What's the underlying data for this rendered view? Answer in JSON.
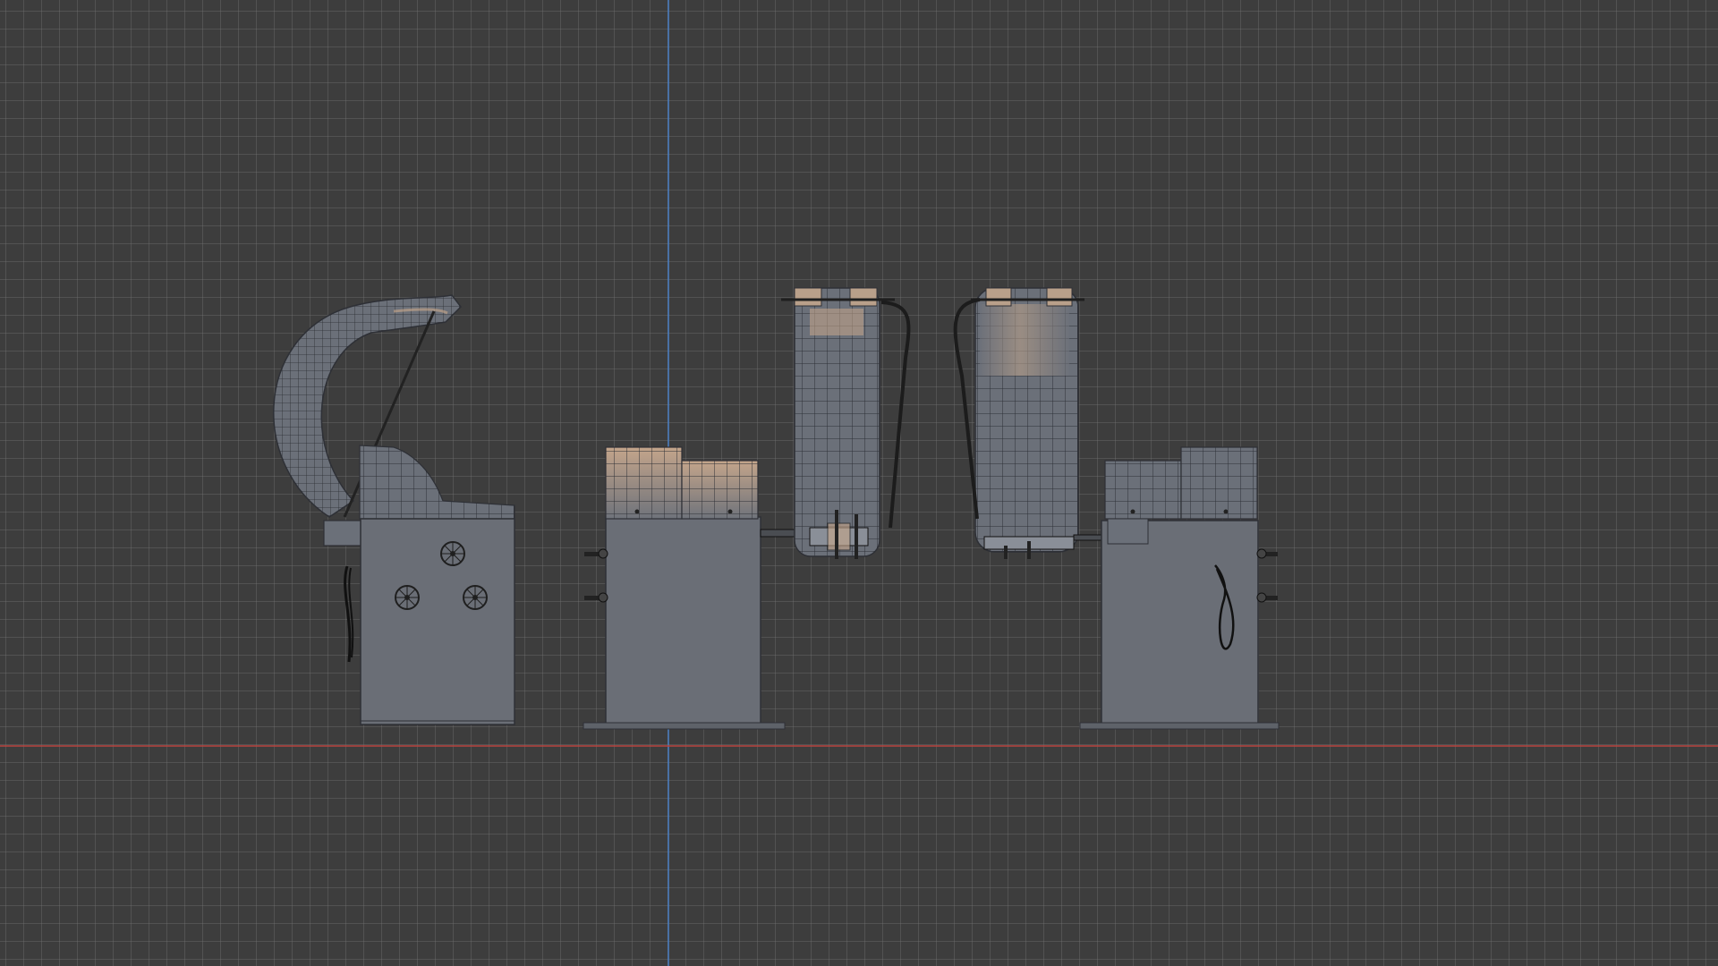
{
  "viewport": {
    "mode": "orthographic-wireframe-overlay",
    "background_color": "#3d3d3d",
    "grid_color": "#595959",
    "x_axis_color": "#b8443f",
    "y_axis_color": "#4a7fc4",
    "mesh_fill_color": "#6b7079",
    "mesh_wire_color": "#2e3036",
    "highlight_color": "#c9a88c"
  },
  "objects": [
    {
      "name": "wheel-balancer-side-view",
      "icon": "machine-side"
    },
    {
      "name": "wheel-balancer-front-view",
      "icon": "machine-front"
    },
    {
      "name": "wheel-guard-hood-front",
      "icon": "hood"
    },
    {
      "name": "wheel-guard-hood-back",
      "icon": "hood"
    },
    {
      "name": "wheel-balancer-back-view",
      "icon": "machine-back"
    }
  ]
}
